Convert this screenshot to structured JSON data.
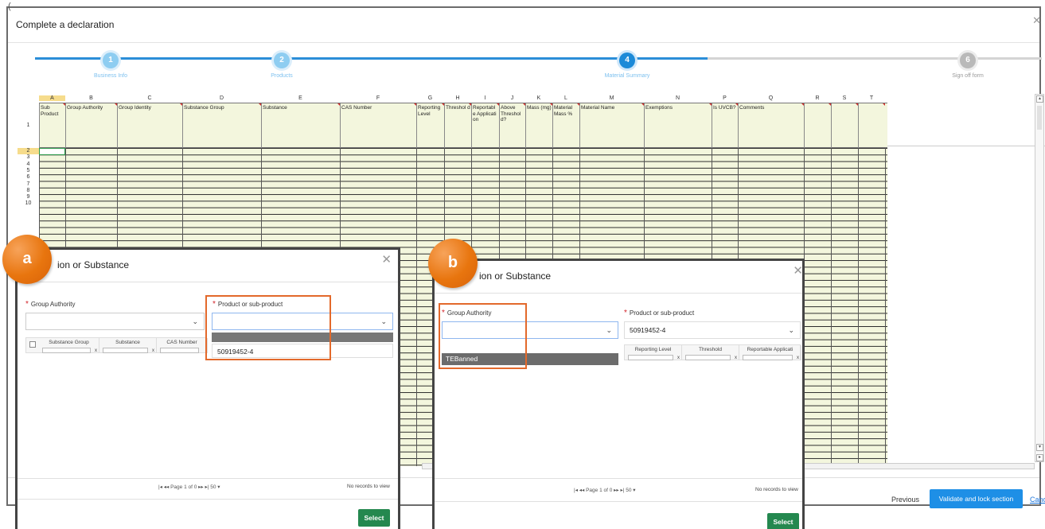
{
  "top_fragment": "(",
  "window": {
    "title": "Complete a declaration"
  },
  "stepper": {
    "steps": [
      {
        "num": "1",
        "label": "Business Info"
      },
      {
        "num": "2",
        "label": "Products"
      },
      {
        "num": "4",
        "label": "Material Summary"
      },
      {
        "num": "6",
        "label": "Sign off form"
      }
    ]
  },
  "spreadsheet": {
    "columns": [
      {
        "letter": "A",
        "header": "Sub Product"
      },
      {
        "letter": "B",
        "header": "Group Authority"
      },
      {
        "letter": "C",
        "header": "Group Identity"
      },
      {
        "letter": "D",
        "header": "Substance Group"
      },
      {
        "letter": "E",
        "header": "Substance"
      },
      {
        "letter": "F",
        "header": "CAS Number"
      },
      {
        "letter": "G",
        "header": "Reporting Level"
      },
      {
        "letter": "H",
        "header": "Threshol d"
      },
      {
        "letter": "I",
        "header": "Reportabl e Applicati on"
      },
      {
        "letter": "J",
        "header": "Above Threshol d?"
      },
      {
        "letter": "K",
        "header": "Mass (mg)"
      },
      {
        "letter": "L",
        "header": "Material Mass %"
      },
      {
        "letter": "M",
        "header": "Material Name"
      },
      {
        "letter": "N",
        "header": "Exemptions"
      },
      {
        "letter": "P",
        "header": "Is UVCB?"
      },
      {
        "letter": "Q",
        "header": "Comments"
      },
      {
        "letter": "R",
        "header": ""
      },
      {
        "letter": "S",
        "header": ""
      },
      {
        "letter": "T",
        "header": ""
      }
    ],
    "rows": [
      "1",
      "2",
      "3",
      "4",
      "5",
      "6",
      "7",
      "8",
      "9",
      "10"
    ],
    "selected_column": "A",
    "selected_row": "2"
  },
  "footer": {
    "previous": "Previous",
    "validate": "Validate and lock section",
    "cancel": "Cancel"
  },
  "dialog_a": {
    "title": "ion or Substance",
    "group_authority_label": "Group Authority",
    "product_label": "Product or sub-product",
    "dropdown_option": "50919452-4",
    "columns": [
      "Substance Group",
      "Substance",
      "CAS Number"
    ],
    "pager": "|◂ ◂◂ Page 1 of 0 ▸▸ ▸| 50 ▾",
    "no_records": "No records to view",
    "select": "Select"
  },
  "dialog_b": {
    "title": "ion or Substance",
    "group_authority_label": "Group Authority",
    "product_label": "Product or sub-product",
    "product_value": "50919452-4",
    "dropdown_option": "TEBanned",
    "columns": [
      "Reporting Level",
      "Threshold",
      "Reportable Applicati"
    ],
    "pager": "|◂ ◂◂ Page 1 of 0 ▸▸ ▸| 50 ▾",
    "no_records": "No records to view",
    "select": "Select"
  },
  "badges": {
    "a": "a",
    "b": "b"
  },
  "colors": {
    "accent_blue": "#1e8fe6",
    "highlight_orange": "#e3692b",
    "select_green": "#24884f",
    "sheet_header_bg": "#f3f6dd",
    "badge_orange": "#e8750e"
  }
}
